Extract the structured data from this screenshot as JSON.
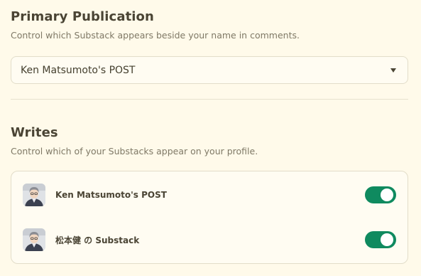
{
  "primary": {
    "heading": "Primary Publication",
    "description": "Control which Substack appears beside your name in comments.",
    "selected": "Ken Matsumoto's POST",
    "caret_icon": "caret-down-icon"
  },
  "writes": {
    "heading": "Writes",
    "description": "Control which of your Substacks appear on your profile.",
    "items": [
      {
        "name": "Ken Matsumoto's POST",
        "enabled": true,
        "avatar_icon": "user-avatar"
      },
      {
        "name": "松本健 の Substack",
        "enabled": true,
        "avatar_icon": "user-avatar"
      }
    ]
  },
  "colors": {
    "background": "#fffaea",
    "toggle_on": "#0f8a5f"
  }
}
